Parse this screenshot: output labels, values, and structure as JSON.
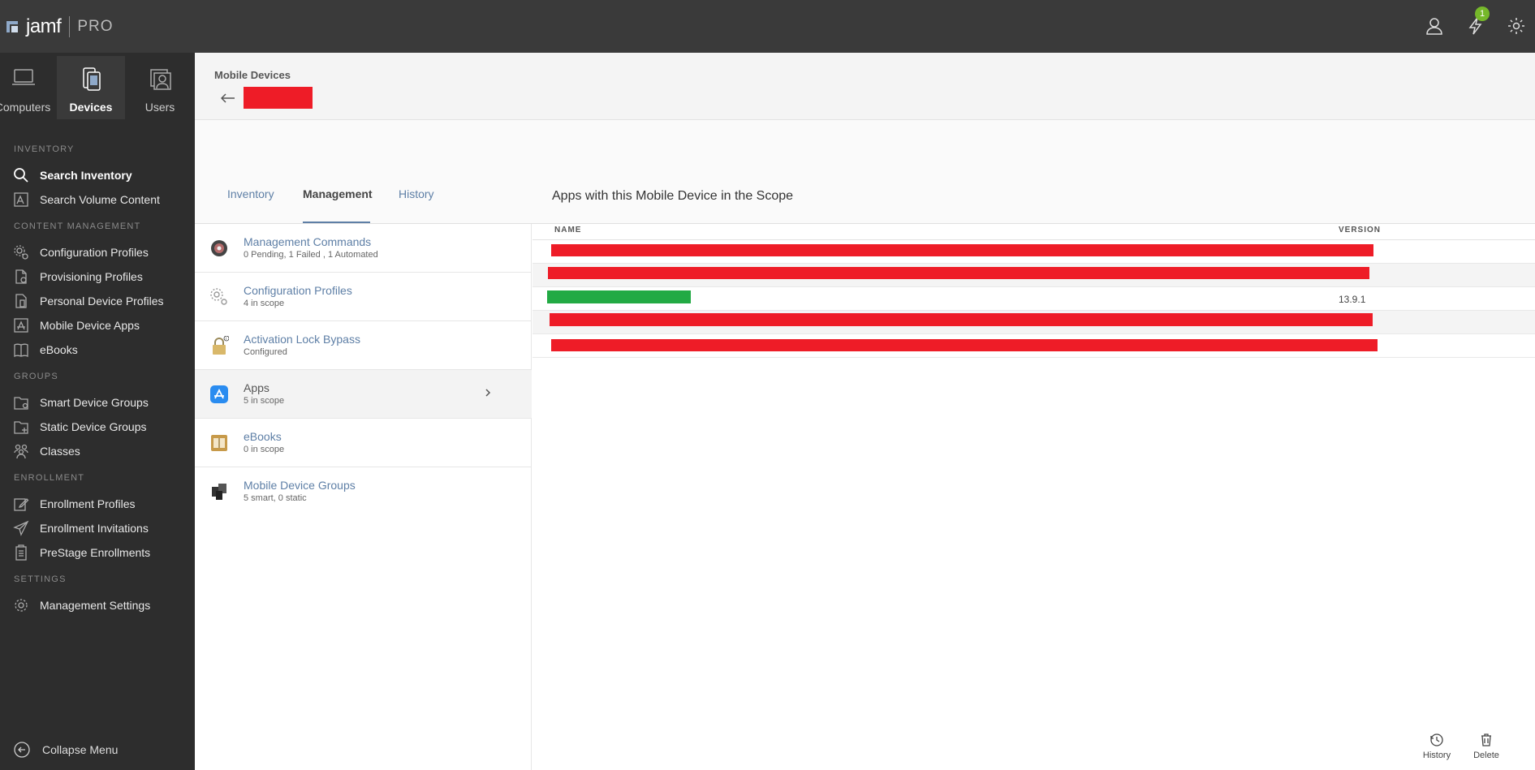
{
  "topbar": {
    "brand": "jamf",
    "product": "PRO",
    "notification_count": "1",
    "icons": [
      "user-icon",
      "lightning-icon",
      "gear-icon"
    ]
  },
  "sidebar": {
    "nav_tabs": [
      {
        "label": "Computers",
        "icon": "laptop-icon"
      },
      {
        "label": "Devices",
        "icon": "mobile-device-icon",
        "active": true
      },
      {
        "label": "Users",
        "icon": "users-icon"
      }
    ],
    "sections": {
      "inventory": "INVENTORY",
      "content_management": "CONTENT MANAGEMENT",
      "groups": "GROUPS",
      "enrollment": "ENROLLMENT",
      "settings": "SETTINGS"
    },
    "items": {
      "search_inventory": "Search Inventory",
      "search_volume_content": "Search Volume Content",
      "configuration_profiles": "Configuration Profiles",
      "provisioning_profiles": "Provisioning Profiles",
      "personal_device_profiles": "Personal Device Profiles",
      "mobile_device_apps": "Mobile Device Apps",
      "ebooks": "eBooks",
      "smart_device_groups": "Smart Device Groups",
      "static_device_groups": "Static Device Groups",
      "classes": "Classes",
      "enrollment_profiles": "Enrollment Profiles",
      "enrollment_invitations": "Enrollment Invitations",
      "prestage_enrollments": "PreStage Enrollments",
      "management_settings": "Management Settings"
    },
    "collapse_label": "Collapse Menu"
  },
  "header": {
    "breadcrumb": "Mobile Devices"
  },
  "tabs": [
    "Inventory",
    "Management",
    "History"
  ],
  "active_tab": "Management",
  "management_items": [
    {
      "title": "Management Commands",
      "sub": "0 Pending, 1 Failed , 1 Automated",
      "icon": "commands-icon"
    },
    {
      "title": "Configuration Profiles",
      "sub": "4 in scope",
      "icon": "gears-icon"
    },
    {
      "title": "Activation Lock Bypass",
      "sub": "Configured",
      "icon": "lock-icon"
    },
    {
      "title": "Apps",
      "sub": "5 in scope",
      "icon": "app-store-icon",
      "active": true
    },
    {
      "title": "eBooks",
      "sub": "0 in scope",
      "icon": "book-icon"
    },
    {
      "title": "Mobile Device Groups",
      "sub": "5 smart, 0 static",
      "icon": "groups-icon"
    }
  ],
  "apps_panel": {
    "title": "Apps with this Mobile Device in the Scope",
    "col_name": "NAME",
    "col_version": "VERSION",
    "rows": [
      {
        "version": ""
      },
      {
        "version": ""
      },
      {
        "version": "13.9.1"
      },
      {
        "version": ""
      },
      {
        "version": ""
      }
    ]
  },
  "actions": {
    "history": "History",
    "delete": "Delete"
  },
  "colors": {
    "topbar": "#3a3a3a",
    "sidebar": "#2d2d2d",
    "link": "#5e7fa6",
    "redaction_red": "#ee1c27",
    "redaction_green": "#22aa44",
    "badge_green": "#76b82a"
  }
}
